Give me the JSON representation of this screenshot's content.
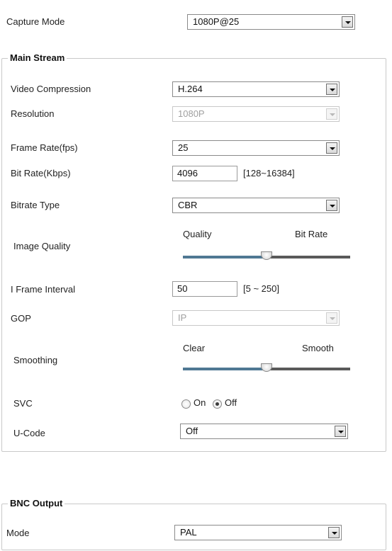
{
  "capture_mode": {
    "label": "Capture Mode",
    "value": "1080P@25"
  },
  "main_stream": {
    "legend": "Main Stream",
    "video_compression": {
      "label": "Video Compression",
      "value": "H.264"
    },
    "resolution": {
      "label": "Resolution",
      "value": "1080P"
    },
    "frame_rate": {
      "label": "Frame Rate(fps)",
      "value": "25"
    },
    "bit_rate": {
      "label": "Bit Rate(Kbps)",
      "value": "4096",
      "range": "[128~16384]"
    },
    "bitrate_type": {
      "label": "Bitrate Type",
      "value": "CBR"
    },
    "image_quality": {
      "label": "Image Quality",
      "left": "Quality",
      "right": "Bit Rate",
      "level": 0.5
    },
    "i_frame_interval": {
      "label": "I Frame Interval",
      "value": "50",
      "range": "[5 ~ 250]"
    },
    "gop": {
      "label": "GOP",
      "value": "IP"
    },
    "smoothing": {
      "label": "Smoothing",
      "left": "Clear",
      "right": "Smooth",
      "level": 0.5
    },
    "svc": {
      "label": "SVC",
      "on_label": "On",
      "off_label": "Off",
      "selected": "Off"
    },
    "u_code": {
      "label": "U-Code",
      "value": "Off"
    }
  },
  "bnc_output": {
    "legend": "BNC Output",
    "mode": {
      "label": "Mode",
      "value": "PAL"
    }
  },
  "colors": {
    "slider_filled": "#4f7893",
    "slider_rest": "#5a5a5a",
    "border": "#c9c9c9"
  }
}
